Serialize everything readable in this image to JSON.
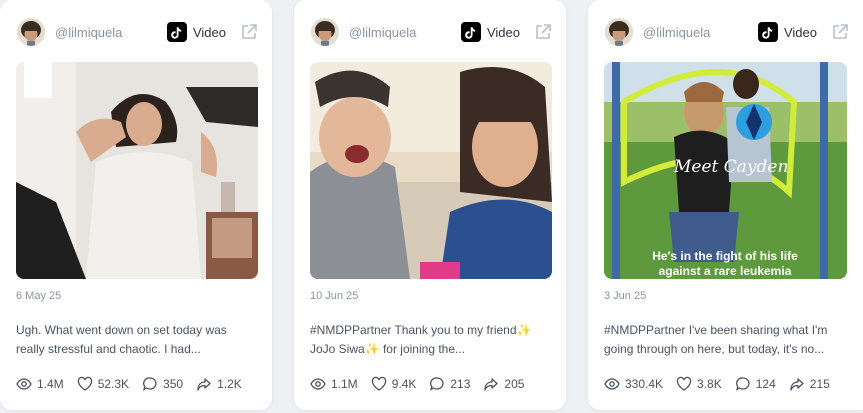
{
  "cards": [
    {
      "handle": "@lilmiquela",
      "platform": "Video",
      "platform_icon": "tiktok-icon",
      "date": "6 May 25",
      "caption": "Ugh. What went down on set today was really stressful and chaotic. I had...",
      "stats": {
        "views": "1.4M",
        "likes": "52.3K",
        "comments": "350",
        "shares": "1.2K"
      }
    },
    {
      "handle": "@lilmiquela",
      "platform": "Video",
      "platform_icon": "tiktok-icon",
      "date": "10 Jun 25",
      "caption": "#NMDPPartner Thank you to my friend✨ JoJo Siwa✨ for joining the...",
      "stats": {
        "views": "1.1M",
        "likes": "9.4K",
        "comments": "213",
        "shares": "205"
      }
    },
    {
      "handle": "@lilmiquela",
      "platform": "Video",
      "platform_icon": "tiktok-icon",
      "date": "3 Jun 25",
      "caption": "#NMDPPartner I've been sharing what I'm going through on here, but today, it's no...",
      "overlay_line1": "He's in the fight of his life",
      "overlay_line2": "against a rare leukemia",
      "overlay_script": "Meet Cayden",
      "stats": {
        "views": "330.4K",
        "likes": "3.8K",
        "comments": "124",
        "shares": "215"
      }
    }
  ],
  "colors": {
    "muted": "#8b94a3",
    "text": "#4a5262",
    "card_bg": "#ffffff",
    "page_bg": "#eef0f3"
  }
}
